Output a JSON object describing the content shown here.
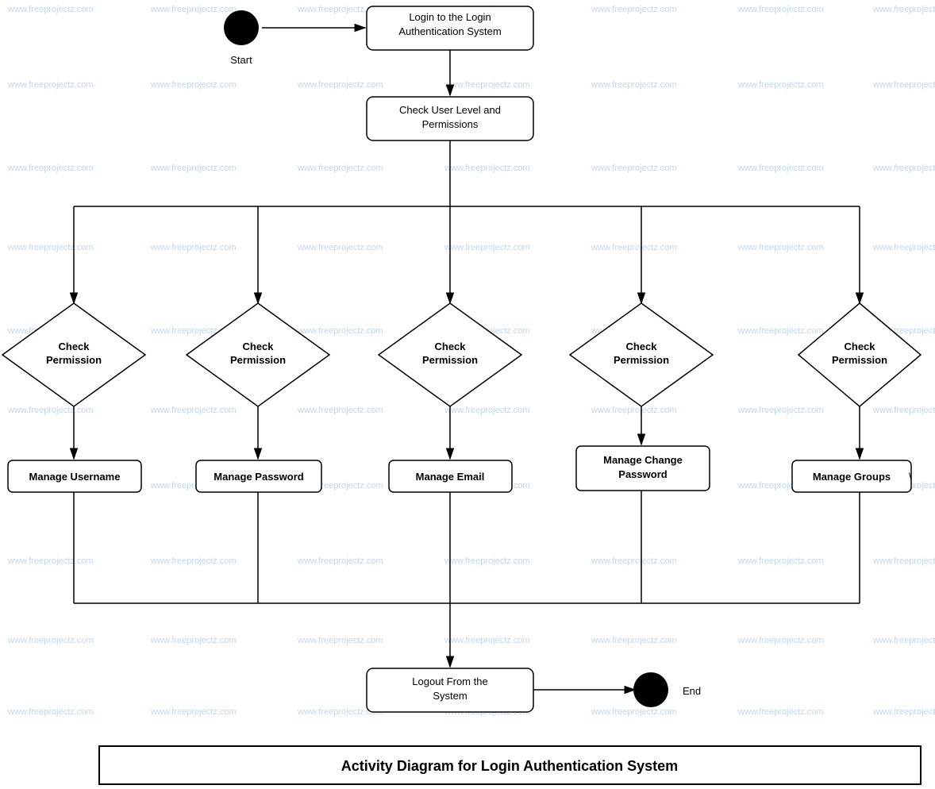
{
  "diagram": {
    "title": "Activity Diagram for Login Authentication System",
    "watermark": "www.freeprojectz.com",
    "nodes": {
      "start_label": "Start",
      "login_box": "Login to the Login Authentication System",
      "check_user_box": "Check User Level and Permissions",
      "diamond1": "Check Permission",
      "diamond2": "Check Permission",
      "diamond3": "Check Permission",
      "diamond4": "Check Permission",
      "diamond5": "Check Permission",
      "manage_username": "Manage Username",
      "manage_password": "Manage Password",
      "manage_email": "Manage Email",
      "manage_change_password": "Manage Change Password",
      "manage_groups": "Manage Groups",
      "logout_box": "Logout From the System",
      "end_label": "End"
    }
  }
}
